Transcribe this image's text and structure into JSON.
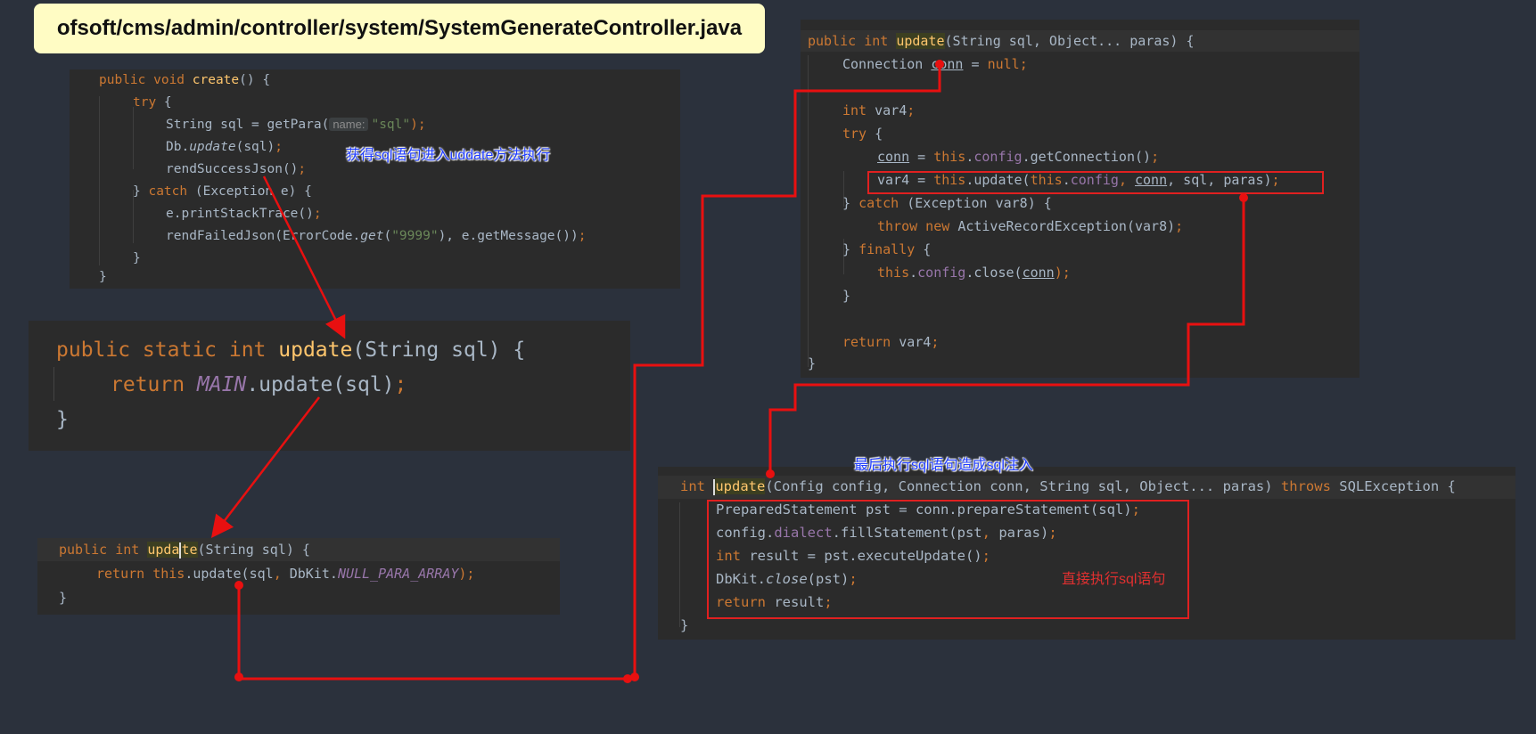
{
  "title": "ofsoft/cms/admin/controller/system/SystemGenerateController.java",
  "notes": {
    "get_sql": "获得sql语句进入uddate方法执行",
    "final_exec": "最后执行sql语句造成sql注入",
    "direct_exec": "直接执行sql语句"
  },
  "code": {
    "create": {
      "l1_kw": "public void ",
      "l1_fn": "create",
      "l1_rest": "() {",
      "l2_kw": "try",
      "l2_rest": " {",
      "l3_a": "String sql = getPara(",
      "l3_hint": "name:",
      "l3_str": "\"sql\"",
      "l3_end": ");",
      "l4_a": "Db.",
      "l4_it": "update",
      "l4_b": "(sql)",
      "l4_end": ";",
      "l5_a": "rendSuccessJson()",
      "l5_end": ";",
      "l6_a": "} ",
      "l6_kw": "catch",
      "l6_b": " (Exception e) {",
      "l7_a": "e.printStackTrace()",
      "l7_end": ";",
      "l8_a": "rendFailedJson(ErrorCode.",
      "l8_it": "get",
      "l8_b": "(",
      "l8_str": "\"9999\"",
      "l8_c": "), e.getMessage())",
      "l8_end": ";",
      "l9": "}",
      "l10": "}"
    },
    "db_static": {
      "l1_kw": "public static int ",
      "l1_fn": "update",
      "l1_rest": "(String sql) {",
      "l2_kw": "return ",
      "l2_fld": "MAIN",
      "l2_rest": ".update(sql)",
      "l2_end": ";",
      "l3": "}"
    },
    "pro_update": {
      "l1_kw": "public int ",
      "l1_fn_a": "upda",
      "l1_fn_b": "te",
      "l1_rest": "(String sql) {",
      "l2_kw": "return this",
      "l2_a": ".update(sql",
      "l2_comma": ", ",
      "l2_b": "DbKit.",
      "l2_fld": "NULL_PARA_ARRAY",
      "l2_end": ");",
      "l3": "}"
    },
    "varargs_update": {
      "l1_kw": "public int ",
      "l1_fn": "update",
      "l1_rest": "(String sql, Object... paras) {",
      "l2_a": "Connection ",
      "l2_ul": "conn",
      "l2_b": " = ",
      "l2_kw": "null",
      "l2_end": ";",
      "l4_kw": "int ",
      "l4_a": "var4",
      "l4_end": ";",
      "l5_kw": "try",
      "l5_a": " {",
      "l6_ul": "conn",
      "l6_a": " = ",
      "l6_kw": "this",
      "l6_b": ".",
      "l6_fld": "config",
      "l6_c": ".getConnection()",
      "l6_end": ";",
      "l7_a": "var4 = ",
      "l7_kw": "this",
      "l7_b": ".update(",
      "l7_kw2": "this",
      "l7_c": ".",
      "l7_fld": "config",
      "l7_d": ", ",
      "l7_ul": "conn",
      "l7_e": ", sql, paras)",
      "l7_end": ";",
      "l8_a": "} ",
      "l8_kw": "catch",
      "l8_b": " (Exception var8) {",
      "l9_kw": "throw new ",
      "l9_a": "ActiveRecordException(var8)",
      "l9_end": ";",
      "l10_a": "} ",
      "l10_kw": "finally",
      "l10_b": " {",
      "l11_kw": "this",
      "l11_a": ".",
      "l11_fld": "config",
      "l11_b": ".close(",
      "l11_ul": "conn",
      "l11_end": ");",
      "l12": "}",
      "l14_kw": "return ",
      "l14_a": "var4",
      "l14_end": ";",
      "l15": "}"
    },
    "exec_update": {
      "l1_kw": "int ",
      "l1_fn": "update",
      "l1_rest": "(Config config, Connection conn, String sql, Object... paras) ",
      "l1_kw2": "throws ",
      "l1_end": "SQLException {",
      "l2_a": "PreparedStatement pst = conn.prepareStatement(sql)",
      "l2_end": ";",
      "l3_a": "config.",
      "l3_fld": "dialect",
      "l3_b": ".fillStatement(pst",
      "l3_comma": ", ",
      "l3_c": "paras)",
      "l3_end": ";",
      "l4_kw": "int ",
      "l4_a": "result = pst.executeUpdate()",
      "l4_end": ";",
      "l5_a": "DbKit.",
      "l5_it": "close",
      "l5_b": "(pst)",
      "l5_end": ";",
      "l6_kw": "return ",
      "l6_a": "result",
      "l6_end": ";",
      "l7": "}"
    }
  },
  "colors": {
    "background": "#2b313c",
    "code_bg": "#2b2b2b",
    "flow_red": "#e81010",
    "title_bg": "#fffcc4"
  }
}
